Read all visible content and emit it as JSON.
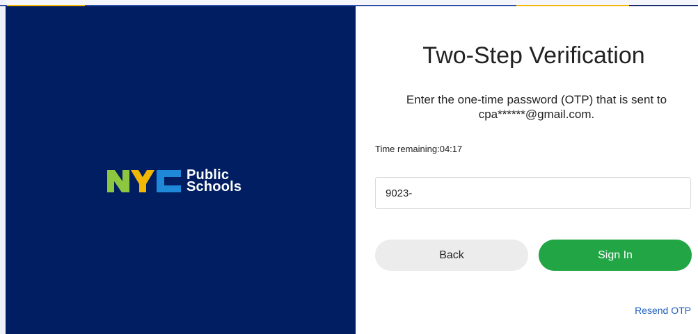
{
  "brand": {
    "logo_text_line1": "Public",
    "logo_text_line2": "Schools",
    "logo_icon": "nyc-logo-mark",
    "panel_color": "#001e61",
    "logo_colors": [
      "#8dc63f",
      "#f2b705",
      "#1f88d9"
    ]
  },
  "form": {
    "title": "Two-Step Verification",
    "instructions": "Enter the one-time password (OTP) that is sent to cpa******@gmail.com.",
    "timer_label": "Time remaining:04:17",
    "otp_value": "9023-",
    "back_label": "Back",
    "signin_label": "Sign In",
    "resend_label": "Resend OTP",
    "accent_color": "#22a545",
    "link_color": "#1f5fbf"
  }
}
